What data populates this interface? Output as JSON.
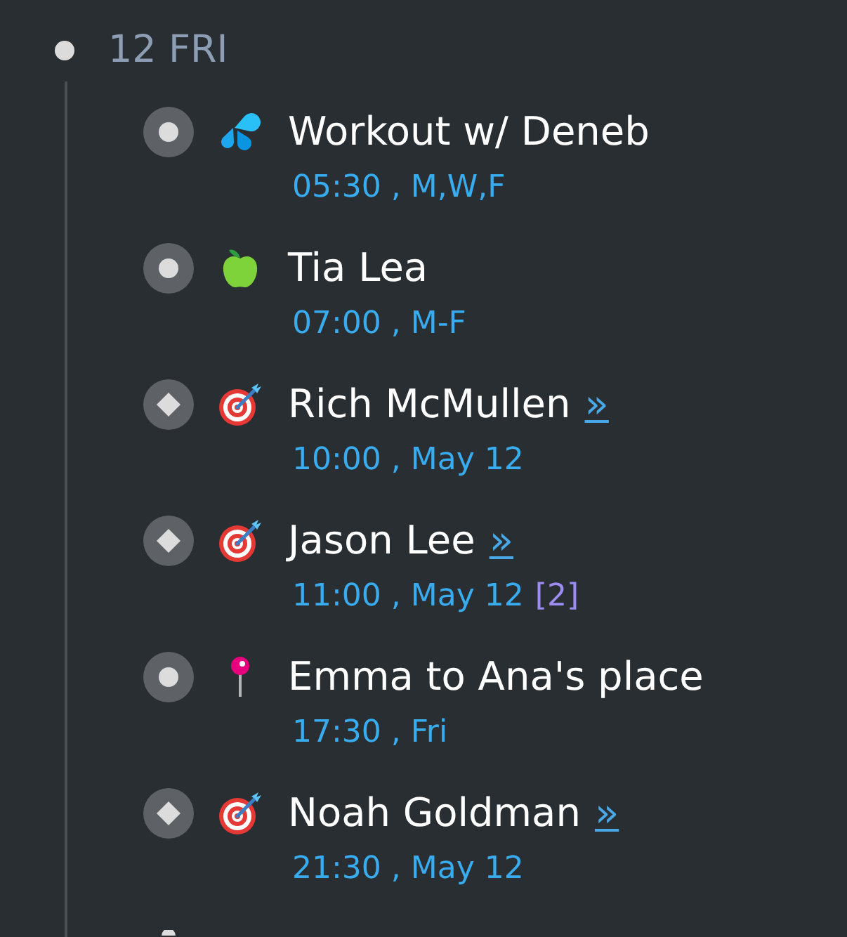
{
  "day": {
    "label": "12 FRI"
  },
  "events": [
    {
      "kind": "exercise",
      "recurring": true,
      "title": "Workout w/ Deneb",
      "schedule": "05:30 , M,W,F"
    },
    {
      "kind": "meal",
      "recurring": true,
      "title": "Tia Lea",
      "schedule": "07:00 , M-F"
    },
    {
      "kind": "goal",
      "recurring": false,
      "title": "Rich McMullen",
      "link": "»",
      "schedule": "10:00 , May 12"
    },
    {
      "kind": "goal",
      "recurring": false,
      "title": "Jason Lee",
      "link": "»",
      "schedule": "11:00 , May 12",
      "count": "[2]"
    },
    {
      "kind": "place",
      "recurring": true,
      "title": "Emma to Ana's place",
      "schedule": "17:30 , Fri"
    },
    {
      "kind": "goal",
      "recurring": false,
      "title": "Noah Goldman",
      "link": "»",
      "schedule": "21:30 , May 12"
    }
  ]
}
